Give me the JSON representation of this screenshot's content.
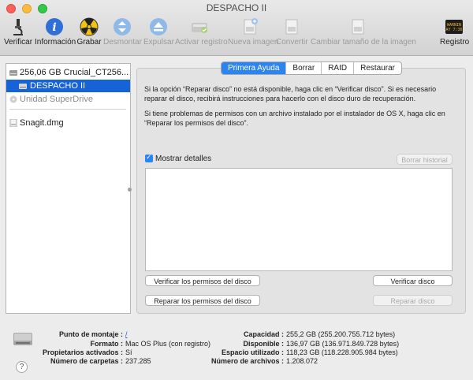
{
  "window": {
    "title": "DESPACHO II"
  },
  "toolbar": [
    {
      "label": "Verificar",
      "icon": "microscope-icon",
      "enabled": true
    },
    {
      "label": "Información",
      "icon": "info-icon",
      "enabled": true
    },
    {
      "label": "Grabar",
      "icon": "burn-icon",
      "enabled": true
    },
    {
      "label": "Desmontar",
      "icon": "unmount-icon",
      "enabled": false
    },
    {
      "label": "Expulsar",
      "icon": "eject-icon",
      "enabled": false
    },
    {
      "label": "Activar registro",
      "icon": "journal-icon",
      "enabled": false
    },
    {
      "label": "Nueva imagen",
      "icon": "new-image-icon",
      "enabled": false
    },
    {
      "label": "Convertir",
      "icon": "convert-icon",
      "enabled": false
    },
    {
      "label": "Cambiar tamaño de la imagen",
      "icon": "resize-image-icon",
      "enabled": false
    },
    {
      "label": "Registro",
      "icon": "log-icon",
      "enabled": true
    },
    {
      "badge": "WARNIN\nAY 7:36"
    }
  ],
  "sidebar": {
    "items": [
      {
        "label": "256,06 GB Crucial_CT256...",
        "icon": "internal-disk-icon"
      },
      {
        "label": "DESPACHO II",
        "icon": "volume-icon",
        "selected": true
      },
      {
        "label": "Unidad SuperDrive",
        "icon": "superdrive-icon",
        "dimmed": true
      },
      {
        "label": "Snagit.dmg",
        "icon": "dmg-icon"
      }
    ]
  },
  "tabs": [
    {
      "label": "Primera Ayuda",
      "active": true
    },
    {
      "label": "Borrar"
    },
    {
      "label": "RAID"
    },
    {
      "label": "Restaurar"
    }
  ],
  "first_aid": {
    "paragraph1": "Si la opción “Reparar disco” no está disponible, haga clic en “Verificar disco”. Si es necesario reparar el disco, recibirá instrucciones para hacerlo con el disco duro de recuperación.",
    "paragraph2": "Si tiene problemas de permisos con un archivo instalado por el instalador de OS X, haga clic en “Reparar los permisos del disco”.",
    "show_details_label": "Mostrar detalles",
    "show_details_checked": true,
    "clear_history_label": "Borrar historial",
    "verify_permissions_label": "Verificar los permisos del disco",
    "repair_permissions_label": "Reparar los permisos del disco",
    "verify_disk_label": "Verificar disco",
    "repair_disk_label": "Reparar disco"
  },
  "info": {
    "mount_point_label": "Punto de montaje :",
    "mount_point_value": "/",
    "format_label": "Formato :",
    "format_value": "Mac OS Plus (con registro)",
    "owners_label": "Propietarios activados :",
    "owners_value": "Sí",
    "folders_label": "Número de carpetas :",
    "folders_value": "237.285",
    "capacity_label": "Capacidad :",
    "capacity_value": "255,2 GB (255.200.755.712 bytes)",
    "available_label": "Disponible :",
    "available_value": "136,97 GB (136.971.849.728 bytes)",
    "used_label": "Espacio utilizado :",
    "used_value": "118,23 GB (118.228.905.984 bytes)",
    "files_label": "Número de archivos :",
    "files_value": "1.208.072",
    "help_glyph": "?"
  },
  "colors": {
    "selection": "#1663d8",
    "accent": "#2b84f0",
    "link": "#1b5fd6"
  }
}
